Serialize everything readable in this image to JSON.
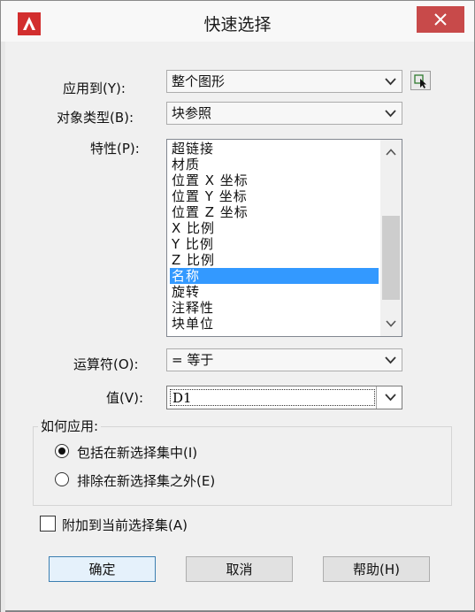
{
  "window": {
    "title": "快速选择"
  },
  "colors": {
    "accent": "#3399ff",
    "close": "#c84a4a",
    "app_icon": "#d22e2e"
  },
  "apply_to": {
    "label": "应用到(Y):",
    "value": "整个图形"
  },
  "object_type": {
    "label": "对象类型(B):",
    "value": "块参照"
  },
  "properties": {
    "label": "特性(P):",
    "items": [
      "超链接",
      "材质",
      "位置 X 坐标",
      "位置 Y 坐标",
      "位置 Z 坐标",
      "X 比例",
      "Y 比例",
      "Z 比例",
      "名称",
      "旋转",
      "注释性",
      "块单位"
    ],
    "selected": "名称"
  },
  "operator": {
    "label": "运算符(O):",
    "value": "= 等于"
  },
  "value": {
    "label": "值(V):",
    "value": "D1"
  },
  "apply_mode": {
    "title": "如何应用:",
    "include_label": "包括在新选择集中(I)",
    "exclude_label": "排除在新选择集之外(E)",
    "selected": "include"
  },
  "append": {
    "label": "附加到当前选择集(A)",
    "checked": false
  },
  "buttons": {
    "ok": "确定",
    "cancel": "取消",
    "help": "帮助(H)"
  }
}
